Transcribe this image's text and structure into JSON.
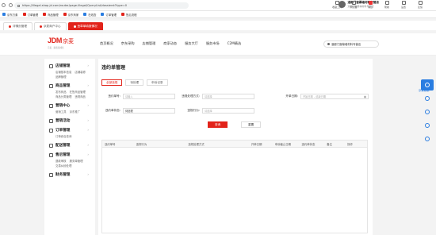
{
  "browser": {
    "url": "https://illegal.shop.jd.com/router/page-illegal/QueryList/dossierst?type=0",
    "toolbar": [
      {
        "label": "收藏工具",
        "icon": "star-icon"
      },
      {
        "label": "浏览器",
        "icon": "browser-icon"
      },
      {
        "label": "消息",
        "icon": "bell-icon",
        "badge": true
      },
      {
        "label": "帮助",
        "icon": "help-icon"
      },
      {
        "label": "设置",
        "icon": "gear-icon"
      },
      {
        "label": "反馈",
        "icon": "feedback-icon"
      }
    ],
    "user": {
      "name": "湛都门窗幕墙材料专营店",
      "sub": "湛都门窗幕墙材料专营店"
    }
  },
  "bookmarks": [
    {
      "label": "京东万象",
      "color": "#2a7de1"
    },
    {
      "label": "订单管理",
      "color": "#e2231a"
    },
    {
      "label": "商品管理",
      "color": "#e2231a"
    },
    {
      "label": "京东商家",
      "color": "#e2231a"
    },
    {
      "label": "在线查",
      "color": "#2a7de1"
    },
    {
      "label": "订单管理",
      "color": "#2a7de1"
    },
    {
      "label": "售后流程",
      "color": "#e2231a"
    }
  ],
  "tabs": [
    {
      "label": "详情页管理",
      "active": false
    },
    {
      "label": "京麦商户中心",
      "active": false
    },
    {
      "label": "违章单填报情况",
      "active": true
    }
  ],
  "header": {
    "logo_main": "JDM",
    "logo_cn": "京麦",
    "logo_slogan": "京麦 · 助商家成长",
    "nav": [
      "首页概况",
      "京东采购",
      "店铺管理",
      "商家动态",
      "服务大厅",
      "服务市场",
      "C2M精选"
    ],
    "store_selector": "湛都门窗幕墙材料专营店"
  },
  "sidebar": [
    {
      "title": "店铺管理",
      "links": [
        "店铺基本信息",
        "店铺装修",
        "品牌管理"
      ]
    },
    {
      "title": "商品管理",
      "links": [
        "发布商品",
        "在售商品管理",
        "商品分类管理",
        "违规商品"
      ]
    },
    {
      "title": "营销中心",
      "links": [
        "营销工具",
        "京东推广"
      ]
    },
    {
      "title": "营销活动",
      "links": []
    },
    {
      "title": "订单管理",
      "links": [
        "订单综合查询"
      ]
    },
    {
      "title": "配送管理",
      "links": []
    },
    {
      "title": "售后管理",
      "links": [
        "退款审核",
        "服务单管理",
        "交易纠纷处理"
      ]
    },
    {
      "title": "财务管理",
      "links": []
    }
  ],
  "page": {
    "title": "违约单管理",
    "tabs": [
      "全部违规",
      "待处理",
      "申诉记录"
    ],
    "form": {
      "order_no_label": "违约单号:",
      "order_no_placeholder": "请输入",
      "type_label": "违规处理方式:",
      "type_placeholder": "请选择",
      "date_label": "开单日期:",
      "date_start": "开始日期",
      "date_end": "结束日期",
      "status_label": "违约单状态:",
      "status_value": "待处理",
      "source_label": "违规行为:",
      "source_placeholder": "请选择"
    },
    "search_btn": "查询",
    "reset_btn": "重置",
    "columns": [
      "违约单号",
      "违规行为",
      "违规处理方式",
      "开单日期",
      "申诉截止日期",
      "违约单状态",
      "备注",
      "操作"
    ]
  },
  "rightbar": {
    "help": "京麦客服"
  }
}
